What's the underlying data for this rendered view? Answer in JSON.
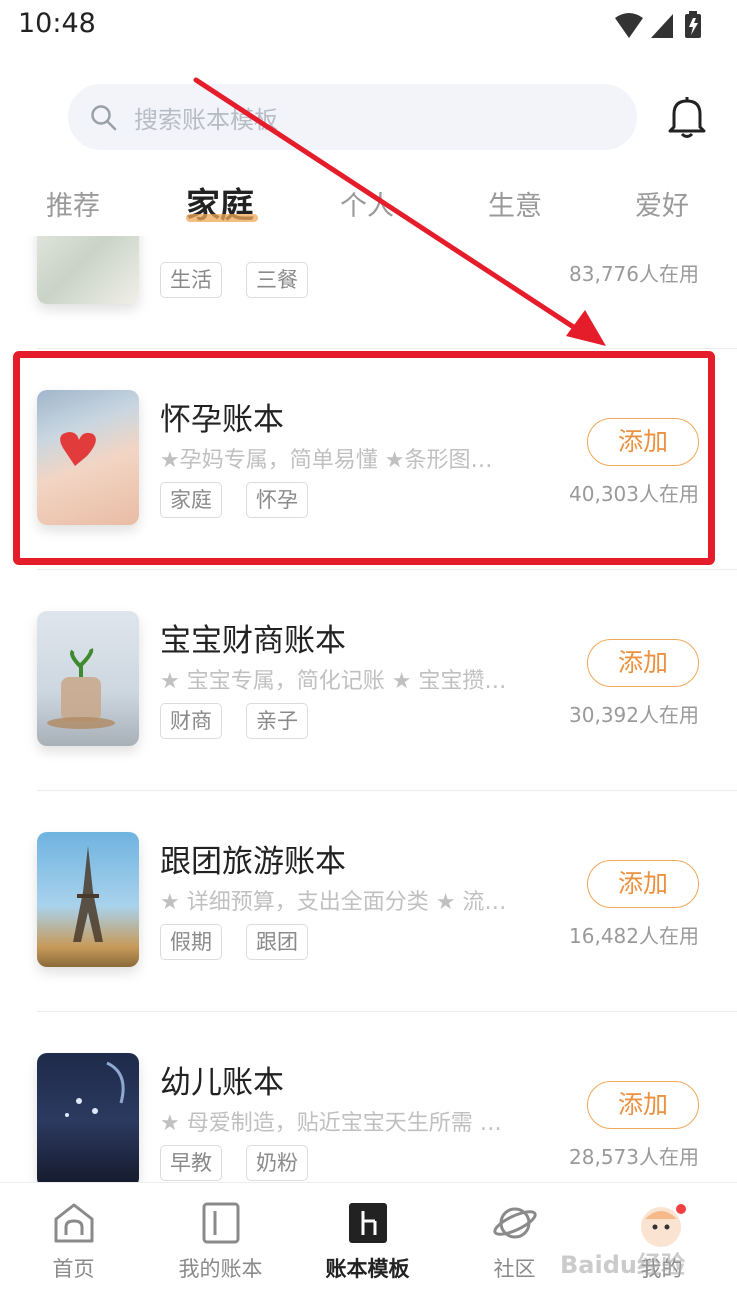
{
  "status": {
    "time": "10:48"
  },
  "search": {
    "placeholder": "搜索账本模板"
  },
  "tabs": [
    {
      "label": "推荐",
      "active": false
    },
    {
      "label": "家庭",
      "active": true
    },
    {
      "label": "个人",
      "active": false
    },
    {
      "label": "生意",
      "active": false
    },
    {
      "label": "爱好",
      "active": false
    }
  ],
  "partial_item": {
    "tags": [
      "生活",
      "三餐"
    ],
    "users": "83,776人在用"
  },
  "items": [
    {
      "title": "怀孕账本",
      "desc": "★孕妈专属，简单易懂 ★条形图…",
      "tags": [
        "家庭",
        "怀孕"
      ],
      "add": "添加",
      "users": "40,303人在用"
    },
    {
      "title": "宝宝财商账本",
      "desc": "★ 宝宝专属，简化记账 ★ 宝宝攒…",
      "tags": [
        "财商",
        "亲子"
      ],
      "add": "添加",
      "users": "30,392人在用"
    },
    {
      "title": "跟团旅游账本",
      "desc": "★ 详细预算，支出全面分类 ★ 流…",
      "tags": [
        "假期",
        "跟团"
      ],
      "add": "添加",
      "users": "16,482人在用"
    },
    {
      "title": "幼儿账本",
      "desc": "★ 母爱制造，贴近宝宝天生所需 …",
      "tags": [
        "早教",
        "奶粉"
      ],
      "add": "添加",
      "users": "28,573人在用"
    }
  ],
  "bottom_nav": [
    {
      "label": "首页",
      "icon": "home-icon"
    },
    {
      "label": "我的账本",
      "icon": "ledger-icon"
    },
    {
      "label": "账本模板",
      "icon": "template-icon",
      "active": true
    },
    {
      "label": "社区",
      "icon": "planet-icon"
    },
    {
      "label": "我的",
      "icon": "avatar-icon"
    }
  ],
  "watermark": "Baidu经验",
  "colors": {
    "accent": "#eb9140",
    "highlight": "#e51c2a"
  }
}
